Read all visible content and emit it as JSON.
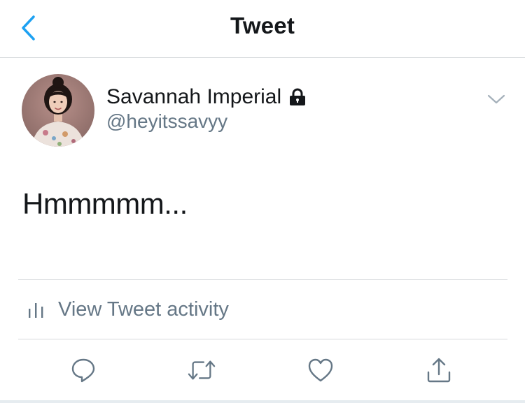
{
  "header": {
    "title": "Tweet",
    "back_icon": "chevron-left-icon"
  },
  "tweet": {
    "author": {
      "display_name": "Savannah Imperial",
      "handle": "@heyitssavyy",
      "protected_icon": "lock-icon"
    },
    "text": "Hmmmmm..."
  },
  "activity": {
    "label": "View Tweet activity",
    "icon": "bar-chart-icon"
  },
  "actions": [
    {
      "name": "reply",
      "icon": "reply-icon"
    },
    {
      "name": "retweet",
      "icon": "retweet-icon"
    },
    {
      "name": "like",
      "icon": "heart-icon"
    },
    {
      "name": "share",
      "icon": "share-icon"
    }
  ],
  "colors": {
    "accent": "#1da1f2",
    "text_primary": "#14171a",
    "text_secondary": "#657786",
    "divider": "#d6d9dc"
  }
}
